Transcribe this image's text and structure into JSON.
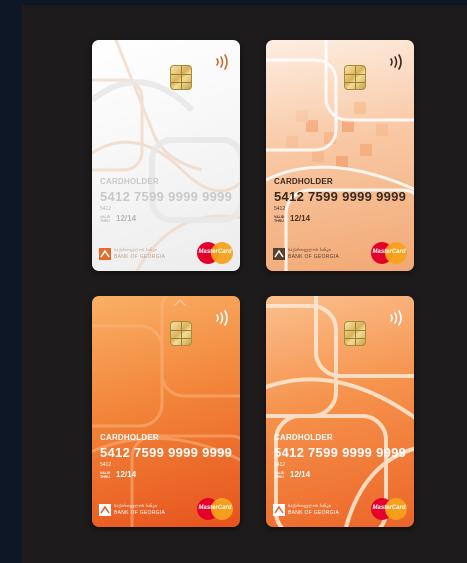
{
  "cards": [
    {
      "theme": "white",
      "colors": {
        "bg1": "#ffffff",
        "bg2": "#eeeeee",
        "line": "#f2d8c6"
      },
      "cardholder": "CARDHOLDER",
      "number": "5412 7599 9999 9999",
      "short": "5412",
      "valid_label": "VALID THRU",
      "expiry": "12/14",
      "bank_line1": "საქართველოს ბანკი",
      "bank_line2": "BANK OF GEORGIA",
      "network": "MasterCard",
      "icons": [
        "chip-icon",
        "contactless-icon",
        "bank-logo-icon",
        "mastercard-logo-icon"
      ]
    },
    {
      "theme": "peach",
      "colors": {
        "bg1": "#fbe6d6",
        "bg2": "#f2a66e",
        "line": "#ffffff"
      },
      "cardholder": "CARDHOLDER",
      "number": "5412 7599 9999 9999",
      "short": "5412",
      "valid_label": "VALID THRU",
      "expiry": "12/14",
      "bank_line1": "საქართველოს ბანკი",
      "bank_line2": "BANK OF GEORGIA",
      "network": "MasterCard",
      "icons": [
        "chip-icon",
        "contactless-icon",
        "bank-logo-icon",
        "mastercard-logo-icon"
      ]
    },
    {
      "theme": "orange",
      "colors": {
        "bg1": "#f7a253",
        "bg2": "#e8541e",
        "line": "#f9b27a"
      },
      "cardholder": "CARDHOLDER",
      "number": "5412 7599 9999 9999",
      "short": "5412",
      "valid_label": "VALID THRU",
      "expiry": "12/14",
      "bank_line1": "საქართველოს ბანკი",
      "bank_line2": "BANK OF GEORGIA",
      "network": "MasterCard",
      "icons": [
        "chip-icon",
        "contactless-icon",
        "bank-logo-icon",
        "mastercard-logo-icon"
      ]
    },
    {
      "theme": "orange-lines",
      "colors": {
        "bg1": "#f8b47c",
        "bg2": "#ee6a2a",
        "line": "#ffe4cc"
      },
      "cardholder": "CARDHOLDER",
      "number": "5412 7599 9999 9999",
      "short": "5412",
      "valid_label": "VALID THRU",
      "expiry": "12/14",
      "bank_line1": "საქართველოს ბანკი",
      "bank_line2": "BANK OF GEORGIA",
      "network": "MasterCard",
      "icons": [
        "chip-icon",
        "contactless-icon",
        "bank-logo-icon",
        "mastercard-logo-icon"
      ]
    }
  ]
}
